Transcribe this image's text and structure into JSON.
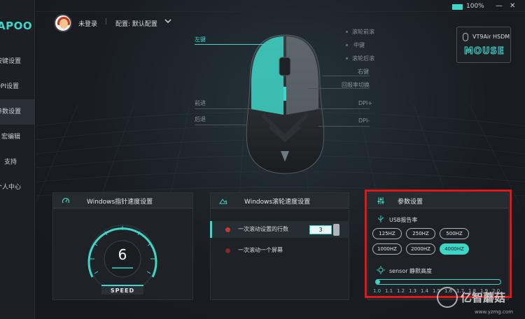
{
  "brand": {
    "logo_text": "APOO",
    "accent": "#3fd6c8"
  },
  "sidebar": {
    "items": [
      {
        "label": "按键设置"
      },
      {
        "label": "DPI设置"
      },
      {
        "label": "参数设置"
      },
      {
        "label": "宏编辑"
      },
      {
        "label": "支持"
      },
      {
        "label": "个人中心"
      }
    ],
    "active_index": 2
  },
  "header": {
    "login": "未登录",
    "separator": "|",
    "config": "配置: 默认配置",
    "battery": "100%",
    "minimize": "—",
    "close": "✕"
  },
  "device": {
    "name": "VT9Air HSDM",
    "type": "MOUSE"
  },
  "mouse_labels": {
    "left_click": "左键",
    "scroll_forward": "滚轮前滚",
    "middle": "中键",
    "scroll_backward": "滚轮后滚",
    "right_click": "右键",
    "report_rate_switch": "回报率切换",
    "forward": "前进",
    "dpi_plus": "DPI+",
    "back": "后退",
    "dpi_minus": "DPI-"
  },
  "pointer_panel": {
    "title": "Windows指针速度设置",
    "value": "6",
    "speed_label": "SPEED"
  },
  "scroll_panel": {
    "title": "Windows滚轮速度设置",
    "option_lines": "一次滚动设置的行数",
    "lines_value": "3",
    "option_screen": "一次滚动一个屏幕"
  },
  "params_panel": {
    "title": "参数设置",
    "usb_label": "USB报告率",
    "rates": [
      "125HZ",
      "250HZ",
      "500HZ",
      "1000HZ",
      "2000HZ",
      "4000HZ"
    ],
    "selected_rate": "4000HZ",
    "sensor_label": "sensor 静默高度",
    "lod_ticks": [
      "1.0",
      "1.1",
      "1.2",
      "1.3",
      "1.4",
      "1.5",
      "1.6",
      "1.7",
      "1.8",
      "1.9",
      "2.0"
    ],
    "lod_value": "1.0"
  },
  "watermark": {
    "text": "亿智蘑菇",
    "url": "www.yzmg.com"
  }
}
